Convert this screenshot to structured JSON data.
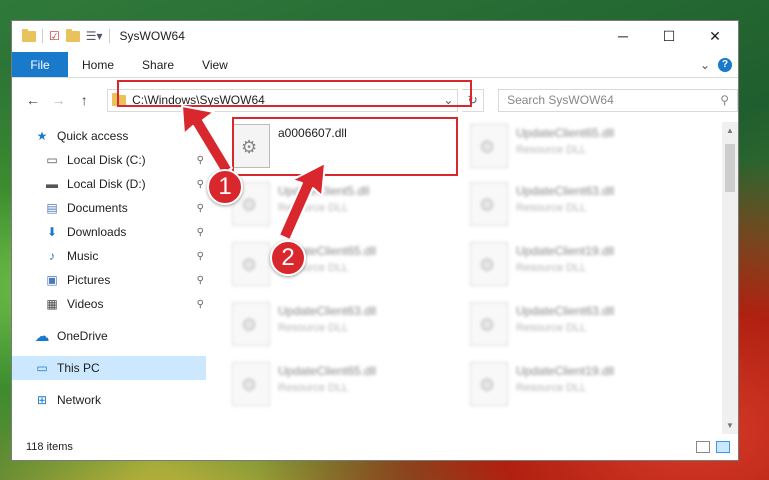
{
  "window": {
    "title": "SysWOW64",
    "min": "─",
    "max": "☐",
    "close": "✕"
  },
  "ribbon": {
    "file": "File",
    "tabs": [
      "Home",
      "Share",
      "View"
    ],
    "help": "?",
    "expand": "⌄"
  },
  "nav": {
    "back": "←",
    "forward": "→",
    "up": "↑",
    "address": "C:\\Windows\\SysWOW64",
    "dropdown": "⌄",
    "refresh": "↻",
    "search_placeholder": "Search SysWOW64",
    "search_icon": "⚲"
  },
  "sidebar": {
    "quick_access": {
      "label": "Quick access",
      "icon": "★"
    },
    "items": [
      {
        "label": "Local Disk (C:)",
        "icon": "▭",
        "pinned": true
      },
      {
        "label": "Local Disk (D:)",
        "icon": "▬",
        "pinned": true
      },
      {
        "label": "Documents",
        "icon": "▤",
        "pinned": true
      },
      {
        "label": "Downloads",
        "icon": "⬇",
        "pinned": true
      },
      {
        "label": "Music",
        "icon": "♪",
        "pinned": true
      },
      {
        "label": "Pictures",
        "icon": "▣",
        "pinned": true
      },
      {
        "label": "Videos",
        "icon": "▦",
        "pinned": true
      }
    ],
    "onedrive": {
      "label": "OneDrive",
      "icon": "☁"
    },
    "thispc": {
      "label": "This PC",
      "icon": "▭"
    },
    "network": {
      "label": "Network",
      "icon": "⊞"
    },
    "pin_glyph": "📌"
  },
  "files": [
    {
      "name": "a0006607.dll",
      "type": ""
    },
    {
      "name": "UpdateClient65.dll",
      "type": "Resource DLL"
    },
    {
      "name": "UpdateClient5.dll",
      "type": "Resource DLL"
    },
    {
      "name": "UpdateClient63.dll",
      "type": "Resource DLL"
    },
    {
      "name": "UpdateClient65.dll",
      "type": "Resource DLL"
    },
    {
      "name": "UpdateClient19.dll",
      "type": "Resource DLL"
    },
    {
      "name": "UpdateClient63.dll",
      "type": "Resource DLL"
    },
    {
      "name": "UpdateClient63.dll",
      "type": "Resource DLL"
    },
    {
      "name": "UpdateClient65.dll",
      "type": "Resource DLL"
    },
    {
      "name": "UpdateClient19.dll",
      "type": "Resource DLL"
    }
  ],
  "status": {
    "count": "118 items"
  },
  "callouts": [
    "1",
    "2"
  ],
  "colors": {
    "accent": "#1979ca",
    "callout": "#d9272e",
    "selected": "#cce8ff"
  }
}
